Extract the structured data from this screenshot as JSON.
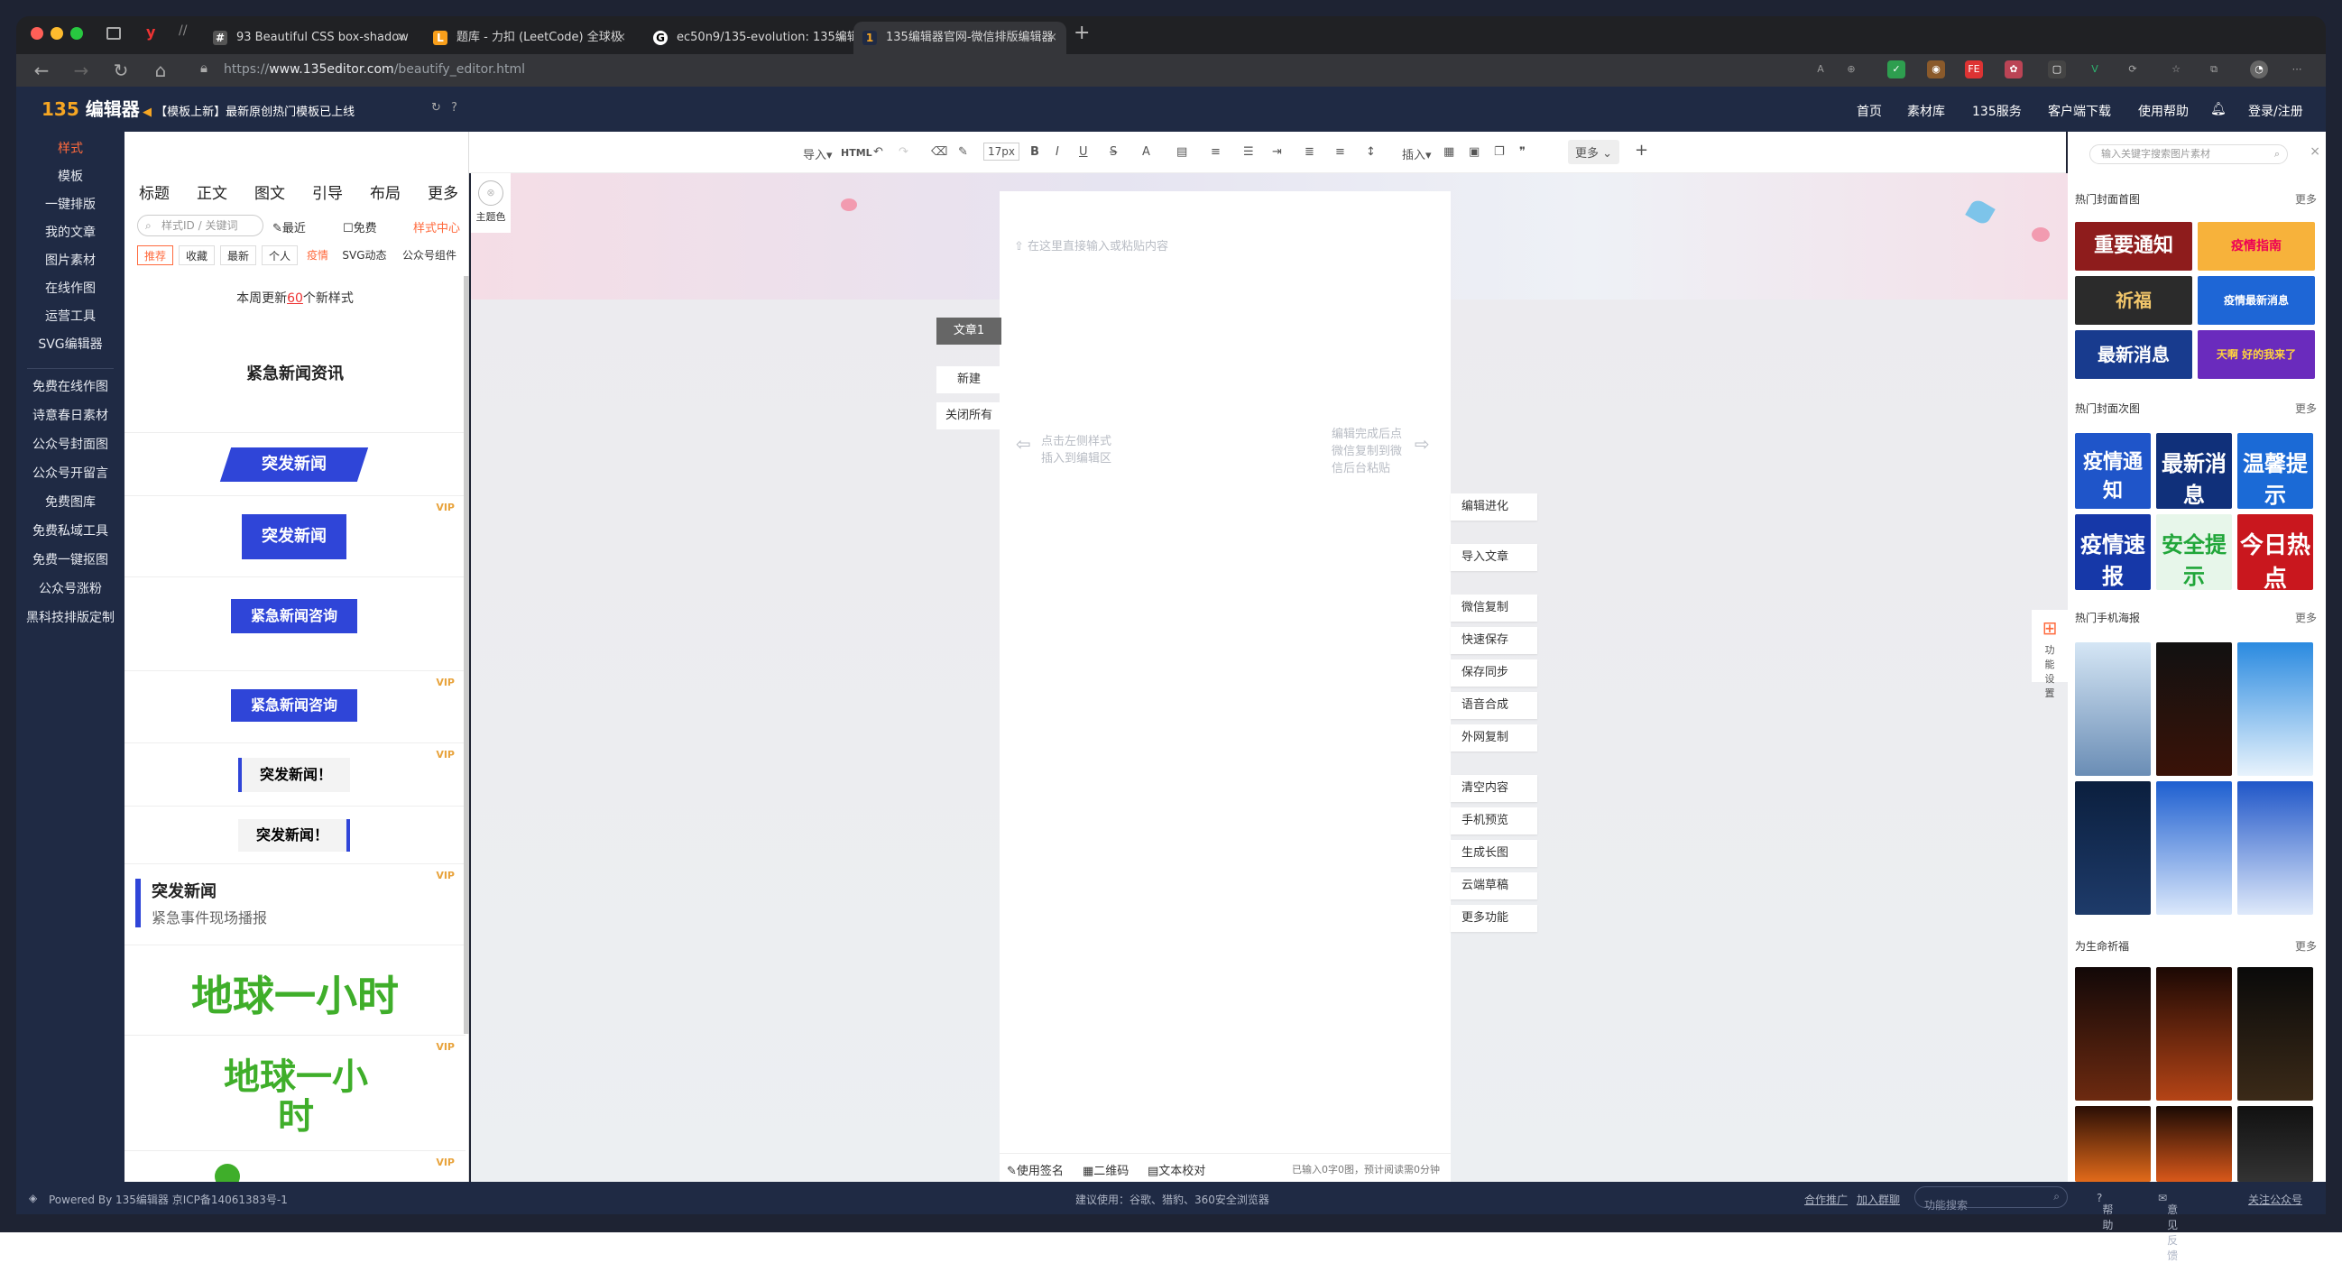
{
  "browser": {
    "tabs": [
      {
        "label": "93 Beautiful CSS box-shadow",
        "icon": "#"
      },
      {
        "label": "题库 - 力扣 (LeetCode) 全球极",
        "icon": "L"
      },
      {
        "label": "ec50n9/135-evolution: 135编辑",
        "icon": "G"
      },
      {
        "label": "135编辑器官网-微信排版编辑器",
        "icon": "1"
      }
    ],
    "url_prefix": "https://",
    "url_domain": "www.135editor.com",
    "url_path": "/beautify_editor.html"
  },
  "header": {
    "logo_num": "135",
    "logo_text": "编辑器",
    "announce": "【模板上新】最新原创热门模板已上线",
    "nav": [
      "首页",
      "素材库",
      "135服务",
      "客户端下载",
      "使用帮助",
      "登录/注册"
    ]
  },
  "leftnav": [
    "样式",
    "模板",
    "一键排版",
    "我的文章",
    "图片素材",
    "在线作图",
    "运营工具",
    "SVG编辑器",
    "免费在线作图",
    "诗意春日素材",
    "公众号封面图",
    "公众号开留言",
    "免费图库",
    "免费私域工具",
    "免费一键抠图",
    "公众号涨粉",
    "黑科技排版定制"
  ],
  "stylepanel": {
    "tabs": [
      "标题",
      "正文",
      "图文",
      "引导",
      "布局",
      "更多"
    ],
    "search_placeholder": "样式ID / 关键词",
    "recent": "最近",
    "free": "免费",
    "center": "样式中心",
    "chips": [
      "推荐",
      "收藏",
      "最新",
      "个人",
      "疫情",
      "SVG动态",
      "公众号组件"
    ],
    "weekly_pre": "本周更新",
    "weekly_num": "60",
    "weekly_post": "个新样式",
    "items": [
      "紧急新闻资讯",
      "突发新闻",
      "突发新闻",
      "紧急新闻咨询",
      "紧急新闻咨询",
      "突发新闻！",
      "突发新闻！",
      "突发新闻",
      "紧急事件现场播报",
      "地球一小时",
      "地球一小时"
    ],
    "vip": "VIP",
    "theme": "主题色"
  },
  "toolbar": {
    "import": "导入",
    "html": "HTML",
    "fontsize": "17px",
    "insert": "插入",
    "more": "更多"
  },
  "editor": {
    "placeholder": "在这里直接输入或粘贴内容",
    "left_hint_1": "点击左侧样式",
    "left_hint_2": "插入到编辑区",
    "right_hint_1": "编辑完成后点",
    "right_hint_2": "微信复制到微",
    "right_hint_3": "信后台粘贴",
    "bottom_sign": "使用签名",
    "bottom_qr": "二维码",
    "bottom_proof": "文本校对",
    "stat": "已输入0字0图，预计阅读需0分钟"
  },
  "docs": {
    "article": "文章1",
    "new": "新建",
    "close_all": "关闭所有"
  },
  "actions": [
    "编辑进化",
    "导入文章",
    "微信复制",
    "快速保存",
    "保存同步",
    "语音合成",
    "外网复制",
    "清空内容",
    "手机预览",
    "生成长图",
    "云端草稿",
    "更多功能"
  ],
  "funcset": "功能设置",
  "rightpanel": {
    "search_placeholder": "输入关键字搜索图片素材",
    "sections": [
      "热门封面首图",
      "热门封面次图",
      "热门手机海报",
      "为生命祈福"
    ],
    "more": "更多",
    "cover1": [
      "重要通知",
      "疫情指南",
      "祈福",
      "疫情最新消息",
      "最新消息",
      "天啊 好的我来了"
    ],
    "cover2": [
      "疫情通知",
      "最新消息",
      "温馨提示",
      "疫情速报",
      "安全提示",
      "今日热点"
    ]
  },
  "footer": {
    "powered": "Powered By 135编辑器 京ICP备14061383号-1",
    "suggest": "建议使用：谷歌、猎豹、360安全浏览器",
    "links": [
      "合作推广",
      "加入群聊"
    ],
    "search_placeholder": "功能搜索",
    "right": [
      "帮助",
      "意见反馈",
      "关注公众号"
    ]
  },
  "colors": {
    "accent": "#ff6a3d",
    "brand_blue": "#2f45d8",
    "header": "#1f2a44"
  }
}
